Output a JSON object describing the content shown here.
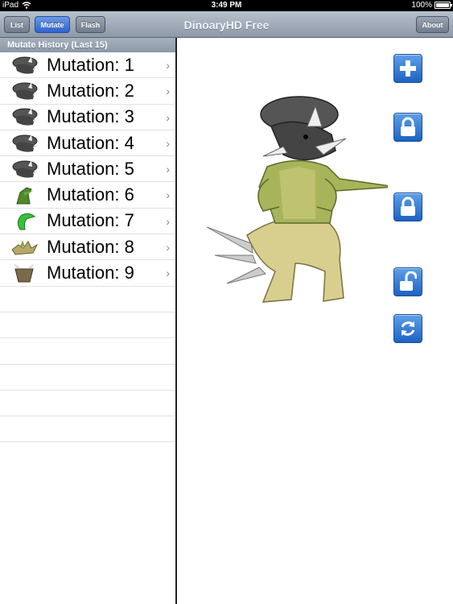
{
  "status_bar": {
    "device": "iPad",
    "time": "3:49 PM",
    "battery": "100%",
    "battery_level": 1.0
  },
  "nav": {
    "title": "DinoaryHD Free",
    "buttons": {
      "list": "List",
      "mutate": "Mutate",
      "flash": "Flash",
      "about": "About"
    }
  },
  "history": {
    "header": "Mutate History (Last 15)",
    "items": [
      {
        "label": "Mutation: 1",
        "thumb": "triceratops-head"
      },
      {
        "label": "Mutation: 2",
        "thumb": "triceratops-head"
      },
      {
        "label": "Mutation: 3",
        "thumb": "triceratops-head"
      },
      {
        "label": "Mutation: 4",
        "thumb": "triceratops-head"
      },
      {
        "label": "Mutation: 5",
        "thumb": "triceratops-head"
      },
      {
        "label": "Mutation: 6",
        "thumb": "green-dino"
      },
      {
        "label": "Mutation: 7",
        "thumb": "green-snake"
      },
      {
        "label": "Mutation: 8",
        "thumb": "stegosaurus"
      },
      {
        "label": "Mutation: 9",
        "thumb": "ceratopsian"
      }
    ],
    "empty_rows": 6
  },
  "controls": [
    "add-icon",
    "lock-icon",
    "lock-icon",
    "unlock-icon",
    "refresh-icon"
  ],
  "colors": {
    "accent": "#2f63cc",
    "nav": "#8d99a8",
    "section": "#98a4b1"
  }
}
